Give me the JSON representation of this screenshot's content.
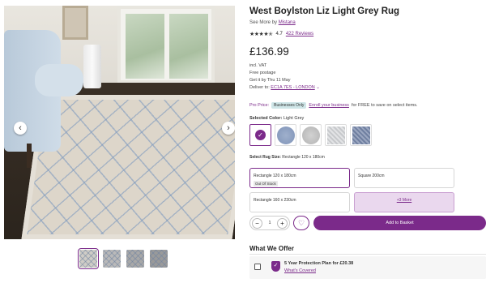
{
  "product": {
    "title": "West Boylston Liz Light Grey Rug",
    "see_more_prefix": "See More by",
    "brand": "Mistana",
    "stars": "★★★★✭",
    "rating": "4.7",
    "reviews": "422 Reviews",
    "price": "£136.99",
    "vat": "incl. VAT",
    "postage": "Free postage",
    "delivery_date": "Get it by Thu 11 May",
    "deliver_to_label": "Deliver to:",
    "deliver_to_value": "EC1A 7ES - LONDON"
  },
  "pro": {
    "label": "Pro Price:",
    "badge": "Businesses Only",
    "link": "Enroll your business",
    "suffix": "for FREE to save on select items."
  },
  "color": {
    "label": "Selected Color:",
    "value": "Light Grey"
  },
  "size": {
    "label": "Select Rug Size:",
    "value": "Rectangle 120 x 180cm",
    "options": [
      {
        "label": "Rectangle 120 x 180cm",
        "note": "Out Of Stock"
      },
      {
        "label": "Square 200cm"
      },
      {
        "label": "Rectangle 160 x 230cm"
      },
      {
        "label": "+3 More"
      }
    ]
  },
  "cart": {
    "quantity": "1",
    "minus": "−",
    "plus": "+",
    "add_label": "Add to Basket"
  },
  "offers": {
    "title": "What We Offer",
    "plan": "5 Year Protection Plan for £20.38",
    "link": "What's Covered"
  },
  "gallery": {
    "prev": "‹",
    "next": "›"
  },
  "colors": {
    "accent": "#7b2a8a",
    "badge_bg": "#cfe6e8",
    "more_bg": "#ead8ee"
  }
}
